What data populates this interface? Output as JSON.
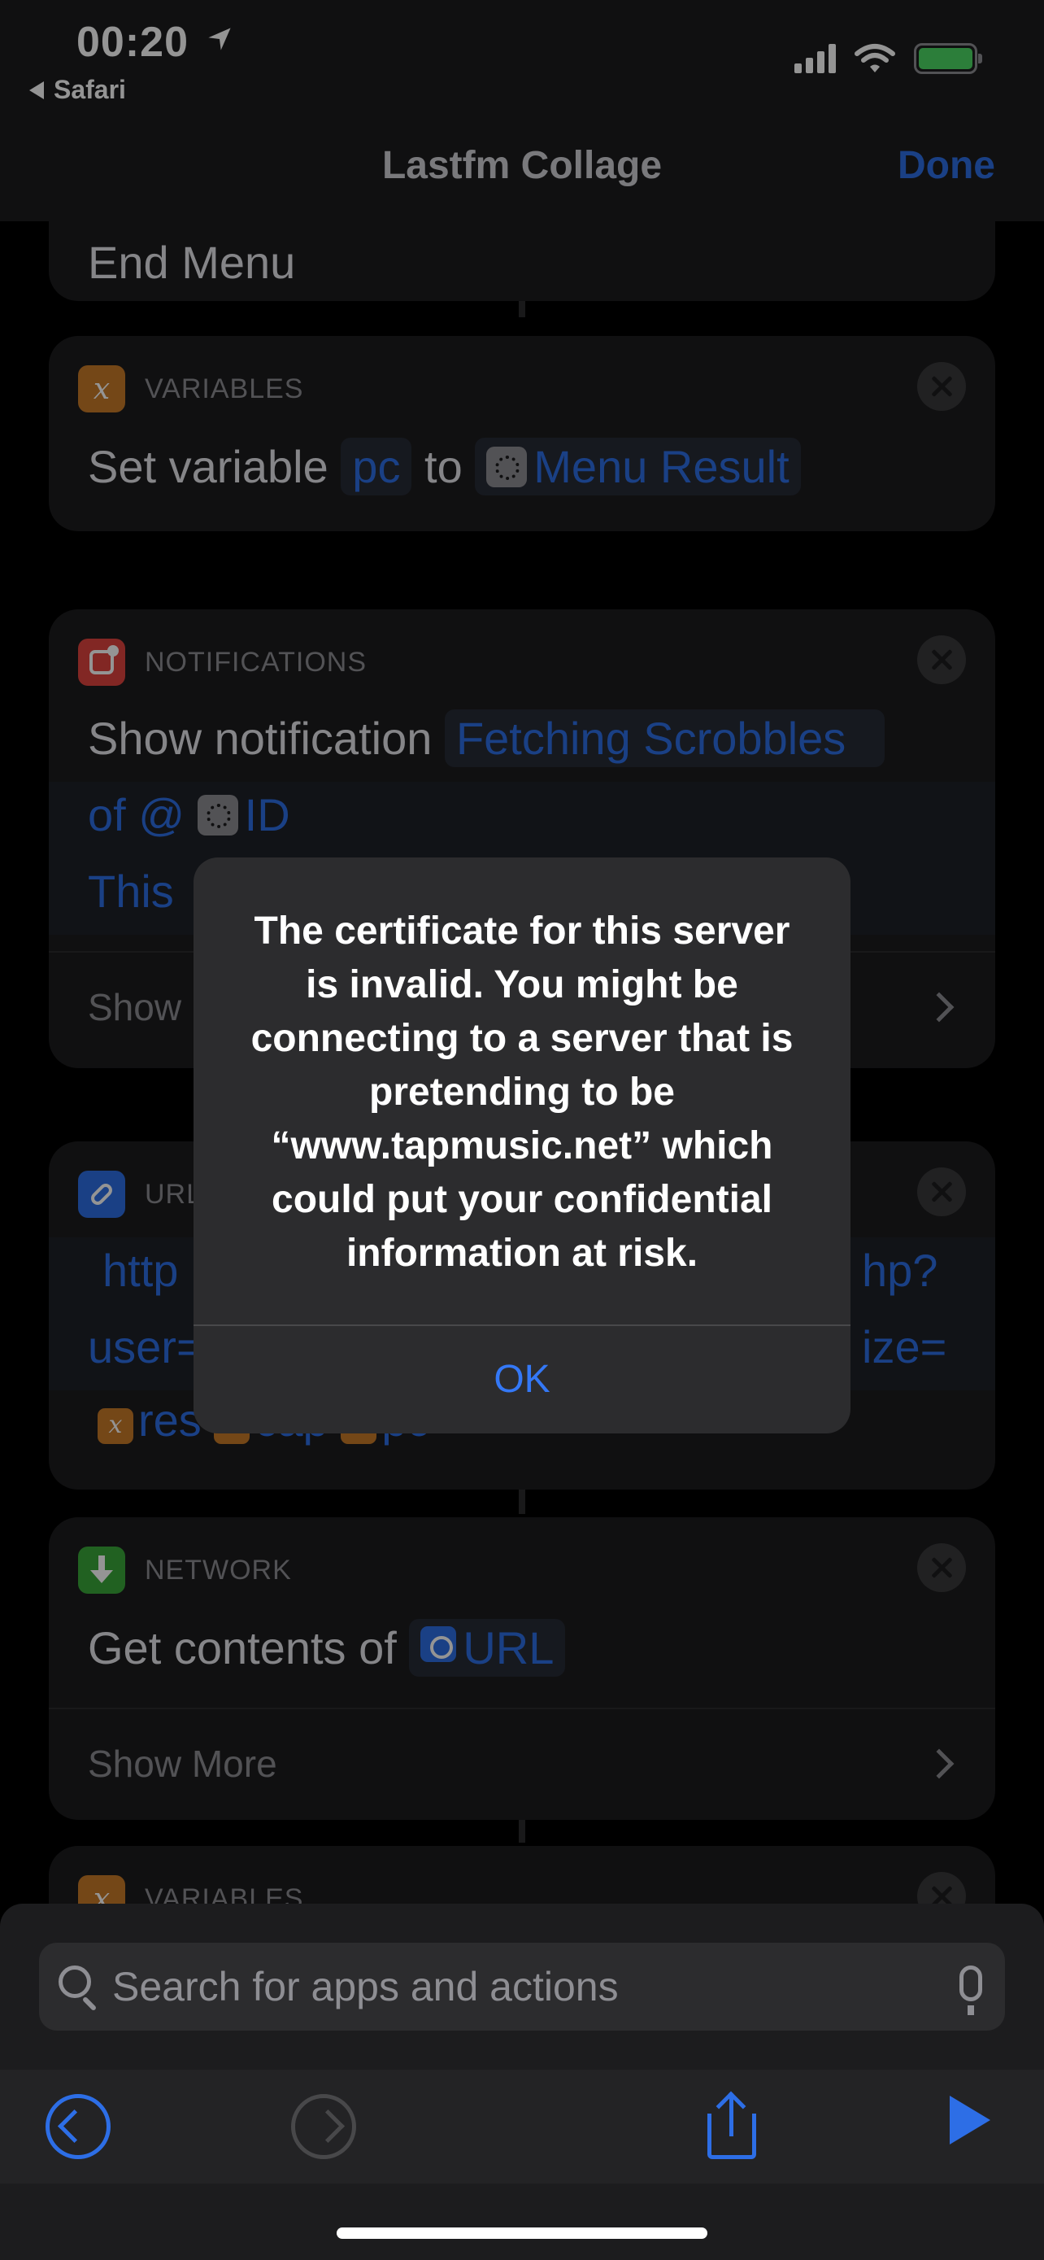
{
  "status_bar": {
    "time": "00:20",
    "back_app": "Safari"
  },
  "nav": {
    "title": "Lastfm Collage",
    "done_label": "Done"
  },
  "actions": {
    "end_menu": "End Menu",
    "set_variable": {
      "category": "VARIABLES",
      "text_prefix": "Set variable",
      "variable": "pc",
      "text_to": "to",
      "value": "Menu Result",
      "category_color": "#c87a28"
    },
    "notification": {
      "category": "NOTIFICATIONS",
      "text_prefix": "Show notification",
      "line1_token": "Fetching Scrobbles",
      "line2_prefix": "of @",
      "line2_var": "ID",
      "line3": "This",
      "show_more": "Show",
      "category_color": "#e0443e"
    },
    "url": {
      "category": "URL",
      "line1_left": "http",
      "line1_right": "hp?",
      "line2_left": "user=",
      "line2_right": "ize=",
      "vars": [
        "res",
        "cap",
        "pc"
      ],
      "category_color": "#2d6ee6"
    },
    "network": {
      "category": "NETWORK",
      "text_prefix": "Get contents of",
      "token": "URL",
      "show_more": "Show More",
      "category_color": "#3aa83a"
    },
    "next_category": "VARIABLES"
  },
  "alert": {
    "message": "The certificate for this server\nis invalid. You might be\nconnecting to a server that is\npretending to be\n“www.tapmusic.net” which\ncould put your confidential\ninformation at risk.",
    "ok_label": "OK"
  },
  "search": {
    "placeholder": "Search for apps and actions"
  },
  "colors": {
    "accent": "#2d6ee6",
    "alert_button": "#3478f6",
    "background": "#000000",
    "card": "#1c1c1e"
  },
  "icons": {
    "location": "location-arrow-icon",
    "undo": "undo-icon",
    "redo": "redo-icon",
    "share": "share-icon",
    "play": "play-icon",
    "search": "search-icon",
    "mic": "microphone-icon"
  }
}
